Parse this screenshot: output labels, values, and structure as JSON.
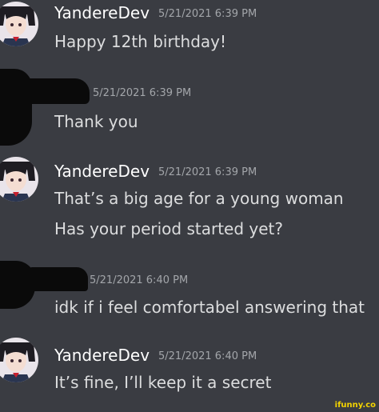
{
  "colors": {
    "background": "#3a3c42",
    "username": "#ffffff",
    "timestamp": "#a3a6aa",
    "message_text": "#dcddde",
    "censor": "#0a0a0a",
    "watermark": "#f4d400"
  },
  "messages": [
    {
      "author": "YandereDev",
      "timestamp": "5/21/2021 6:39 PM",
      "lines": [
        "Happy 12th birthday!"
      ],
      "avatar": "anime-girl-avatar"
    },
    {
      "author": "",
      "timestamp": "5/21/2021 6:39 PM",
      "lines": [
        "Thank you"
      ],
      "avatar": "censored-avatar"
    },
    {
      "author": "YandereDev",
      "timestamp": "5/21/2021 6:39 PM",
      "lines": [
        "That’s a big age for a young woman",
        "Has your period started yet?"
      ],
      "avatar": "anime-girl-avatar"
    },
    {
      "author": "",
      "timestamp": "5/21/2021 6:40 PM",
      "lines": [
        "idk if i feel comfortabel answering that"
      ],
      "avatar": "censored-avatar"
    },
    {
      "author": "YandereDev",
      "timestamp": "5/21/2021 6:40 PM",
      "lines": [
        "It’s fine, I’ll keep it a secret"
      ],
      "avatar": "anime-girl-avatar"
    }
  ],
  "watermark": "ifunny.co"
}
